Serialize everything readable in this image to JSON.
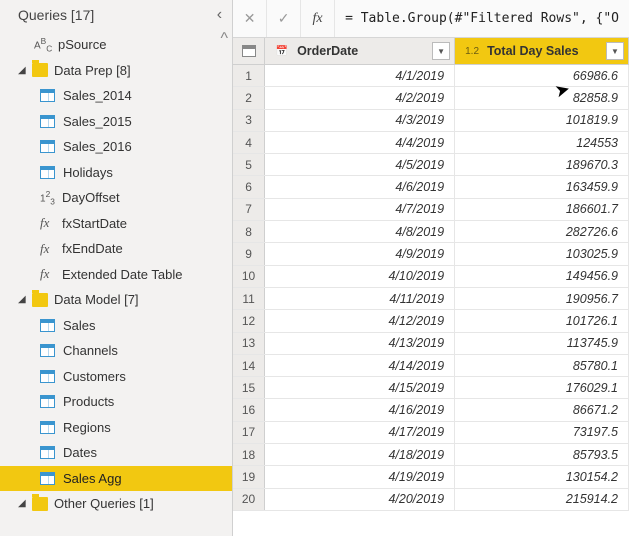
{
  "sidebar": {
    "title": "Queries [17]",
    "pSource": "pSource",
    "groups": [
      {
        "label": "Data Prep [8]",
        "expanded": true,
        "items": [
          {
            "type": "table",
            "label": "Sales_2014"
          },
          {
            "type": "table",
            "label": "Sales_2015"
          },
          {
            "type": "table",
            "label": "Sales_2016"
          },
          {
            "type": "table",
            "label": "Holidays"
          },
          {
            "type": "num",
            "label": "DayOffset"
          },
          {
            "type": "fx",
            "label": "fxStartDate"
          },
          {
            "type": "fx",
            "label": "fxEndDate"
          },
          {
            "type": "fx",
            "label": "Extended Date Table"
          }
        ]
      },
      {
        "label": "Data Model [7]",
        "expanded": true,
        "items": [
          {
            "type": "table",
            "label": "Sales"
          },
          {
            "type": "table",
            "label": "Channels"
          },
          {
            "type": "table",
            "label": "Customers"
          },
          {
            "type": "table",
            "label": "Products"
          },
          {
            "type": "table",
            "label": "Regions"
          },
          {
            "type": "table",
            "label": "Dates"
          },
          {
            "type": "table",
            "label": "Sales Agg",
            "selected": true
          }
        ]
      },
      {
        "label": "Other Queries [1]",
        "expanded": true,
        "items": []
      }
    ]
  },
  "fxbar": {
    "formula": "= Table.Group(#\"Filtered Rows\", {\"O"
  },
  "columns": {
    "c1": {
      "name": "OrderDate",
      "type_badge": "📅"
    },
    "c2": {
      "name": "Total Day Sales",
      "type_badge": "1.2"
    }
  },
  "chart_data": {
    "type": "table",
    "columns": [
      "OrderDate",
      "Total Day Sales"
    ],
    "rows": [
      [
        "4/1/2019",
        66986.6
      ],
      [
        "4/2/2019",
        82858.9
      ],
      [
        "4/3/2019",
        101819.9
      ],
      [
        "4/4/2019",
        124553
      ],
      [
        "4/5/2019",
        189670.3
      ],
      [
        "4/6/2019",
        163459.9
      ],
      [
        "4/7/2019",
        186601.7
      ],
      [
        "4/8/2019",
        282726.6
      ],
      [
        "4/9/2019",
        103025.9
      ],
      [
        "4/10/2019",
        149456.9
      ],
      [
        "4/11/2019",
        190956.7
      ],
      [
        "4/12/2019",
        101726.1
      ],
      [
        "4/13/2019",
        113745.9
      ],
      [
        "4/14/2019",
        85780.1
      ],
      [
        "4/15/2019",
        176029.1
      ],
      [
        "4/16/2019",
        86671.2
      ],
      [
        "4/17/2019",
        73197.5
      ],
      [
        "4/18/2019",
        85793.5
      ],
      [
        "4/19/2019",
        130154.2
      ],
      [
        "4/20/2019",
        215914.2
      ]
    ]
  }
}
